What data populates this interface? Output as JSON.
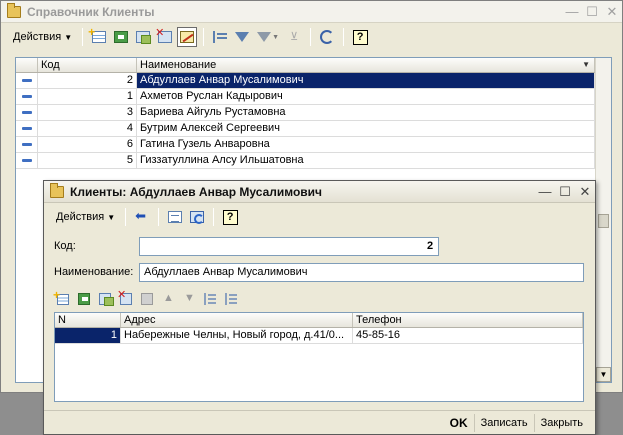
{
  "main": {
    "title": "Справочник Клиенты",
    "actions_label": "Действия",
    "grid": {
      "columns": [
        "",
        "Код",
        "Наименование"
      ],
      "rows": [
        {
          "code": "2",
          "name": "Абдуллаев Анвар Мусалимович"
        },
        {
          "code": "1",
          "name": "Ахметов Руслан Кадырович"
        },
        {
          "code": "3",
          "name": "Бариева Айгуль Рустамовна"
        },
        {
          "code": "4",
          "name": "Бутрим Алексей Сергеевич"
        },
        {
          "code": "6",
          "name": "Гатина Гузель Анваровна"
        },
        {
          "code": "5",
          "name": "Гиззатуллина Алсу Ильшатовна"
        }
      ]
    }
  },
  "dialog": {
    "title": "Клиенты: Абдуллаев Анвар Мусалимович",
    "actions_label": "Действия",
    "code_label": "Код:",
    "code_value": "2",
    "name_label": "Наименование:",
    "name_value": "Абдуллаев Анвар Мусалимович",
    "grid": {
      "columns": [
        "N",
        "Адрес",
        "Телефон"
      ],
      "rows": [
        {
          "n": "1",
          "address": "Набережные Челны, Новый город, д.41/0...",
          "phone": "45-85-16"
        }
      ]
    },
    "buttons": {
      "ok": "OK",
      "save": "Записать",
      "close": "Закрыть"
    }
  },
  "window_buttons": {
    "minimize": "—",
    "maximize": "☐",
    "close": "✕"
  },
  "colors": {
    "selection": "#0a246a",
    "window_bg": "#ece9d8",
    "grid_border": "#7f9db9"
  }
}
